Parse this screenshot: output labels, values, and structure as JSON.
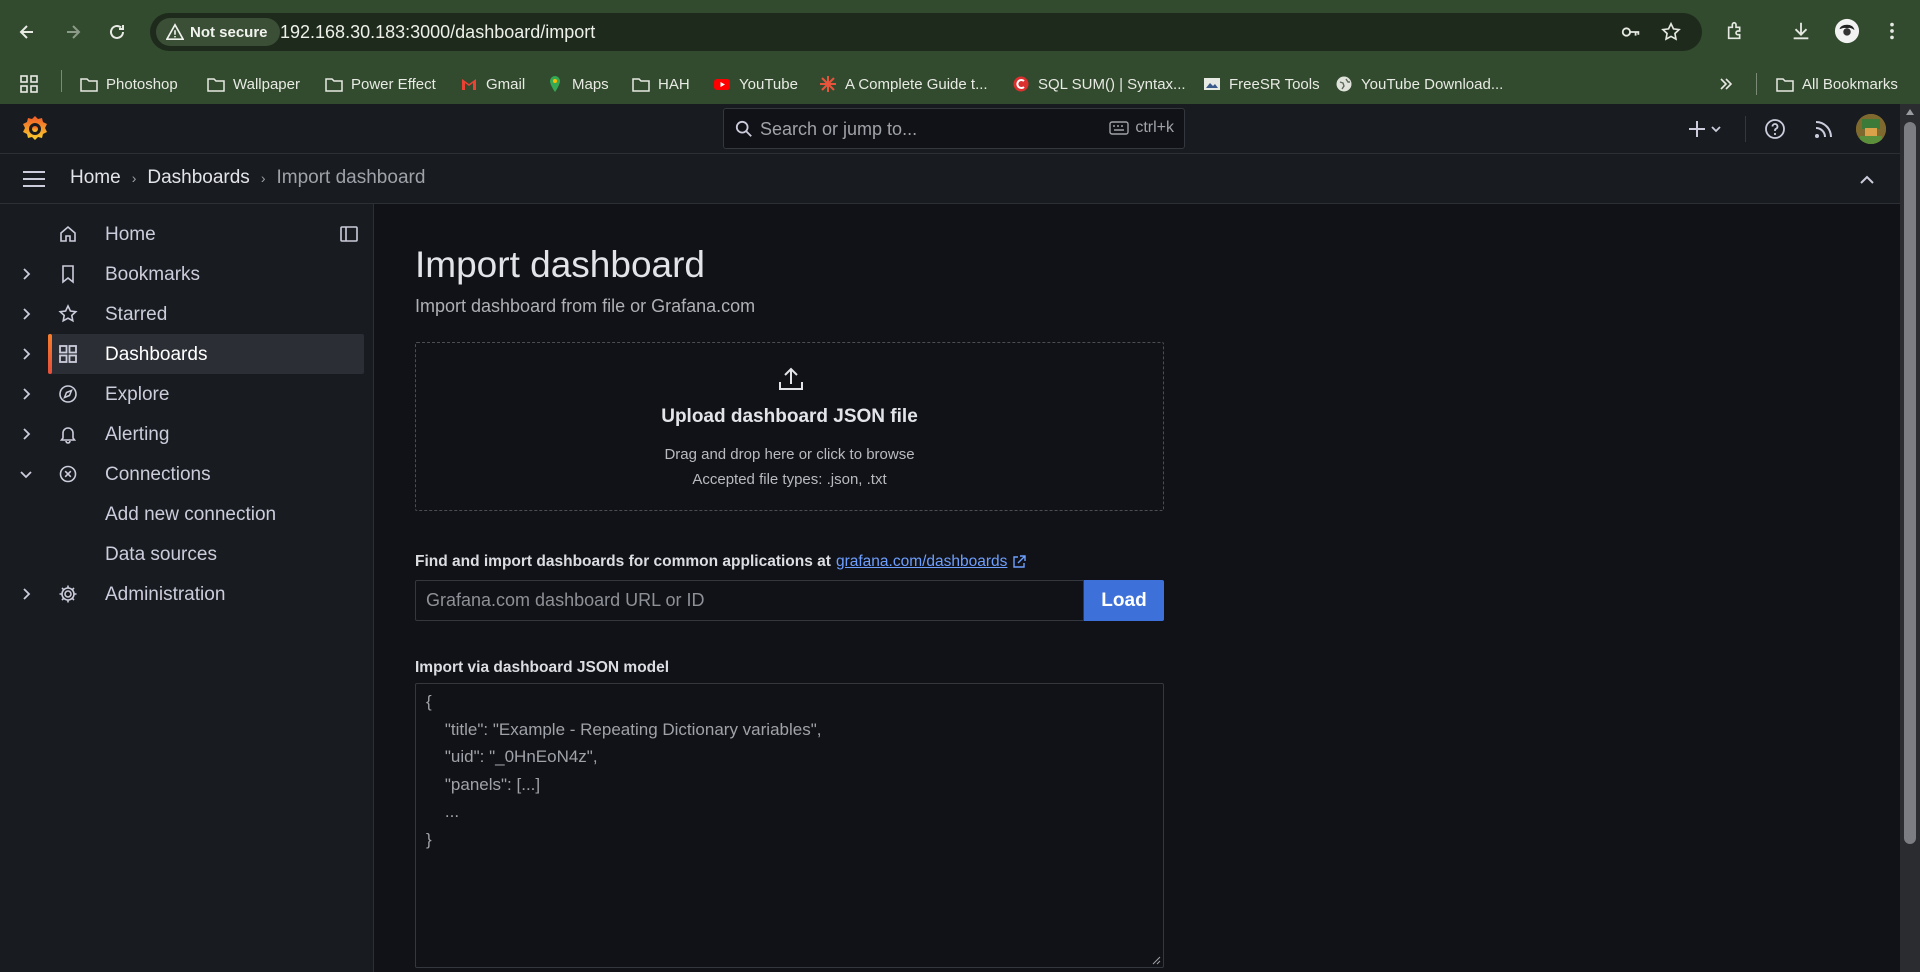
{
  "browser": {
    "security_label": "Not secure",
    "url": "192.168.30.183:3000/dashboard/import",
    "bookmarks": [
      {
        "label": "Photoshop",
        "icon": "folder-icon"
      },
      {
        "label": "Wallpaper",
        "icon": "folder-icon"
      },
      {
        "label": "Power Effect",
        "icon": "folder-icon"
      },
      {
        "label": "Gmail",
        "icon": "gmail-icon"
      },
      {
        "label": "Maps",
        "icon": "maps-icon"
      },
      {
        "label": "HAH",
        "icon": "folder-icon"
      },
      {
        "label": "YouTube",
        "icon": "youtube-icon"
      },
      {
        "label": "A Complete Guide t...",
        "icon": "guide-icon"
      },
      {
        "label": "SQL SUM() | Syntax...",
        "icon": "sql-icon"
      },
      {
        "label": "FreeSR Tools",
        "icon": "freesr-icon"
      },
      {
        "label": "YouTube Download...",
        "icon": "globe-icon"
      }
    ],
    "all_bookmarks": "All Bookmarks"
  },
  "topbar": {
    "search_placeholder": "Search or jump to...",
    "search_shortcut": "ctrl+k"
  },
  "breadcrumb": {
    "home": "Home",
    "dashboards": "Dashboards",
    "current": "Import dashboard"
  },
  "sidebar": {
    "items": [
      {
        "label": "Home",
        "icon": "home-icon"
      },
      {
        "label": "Bookmarks",
        "icon": "bookmark-icon"
      },
      {
        "label": "Starred",
        "icon": "star-icon"
      },
      {
        "label": "Dashboards",
        "icon": "dashboards-grid-icon",
        "active": true
      },
      {
        "label": "Explore",
        "icon": "compass-icon"
      },
      {
        "label": "Alerting",
        "icon": "bell-icon"
      },
      {
        "label": "Connections",
        "icon": "connections-icon"
      },
      {
        "label": "Add new connection",
        "sub": true
      },
      {
        "label": "Data sources",
        "sub": true
      },
      {
        "label": "Administration",
        "icon": "cog-icon"
      }
    ]
  },
  "main": {
    "title": "Import dashboard",
    "subtitle": "Import dashboard from file or Grafana.com",
    "upload": {
      "title": "Upload dashboard JSON file",
      "hint": "Drag and drop here or click to browse",
      "types": "Accepted file types: .json, .txt"
    },
    "find": {
      "label": "Find and import dashboards for common applications at",
      "link": "grafana.com/dashboards",
      "input_placeholder": "Grafana.com dashboard URL or ID",
      "load_button": "Load"
    },
    "json_model": {
      "label": "Import via dashboard JSON model",
      "placeholder_lines": [
        "{",
        "    \"title\": \"Example - Repeating Dictionary variables\",",
        "    \"uid\": \"_0HnEoN4z\",",
        "    \"panels\": [...]",
        "    ...",
        "}"
      ]
    }
  },
  "colors": {
    "chrome": "#324a2e",
    "grafana_bg": "#111217",
    "panel_bg": "#181b1f",
    "primary": "#3d71d9",
    "active_accent": "#f87e2b",
    "link": "#6e9fff"
  }
}
